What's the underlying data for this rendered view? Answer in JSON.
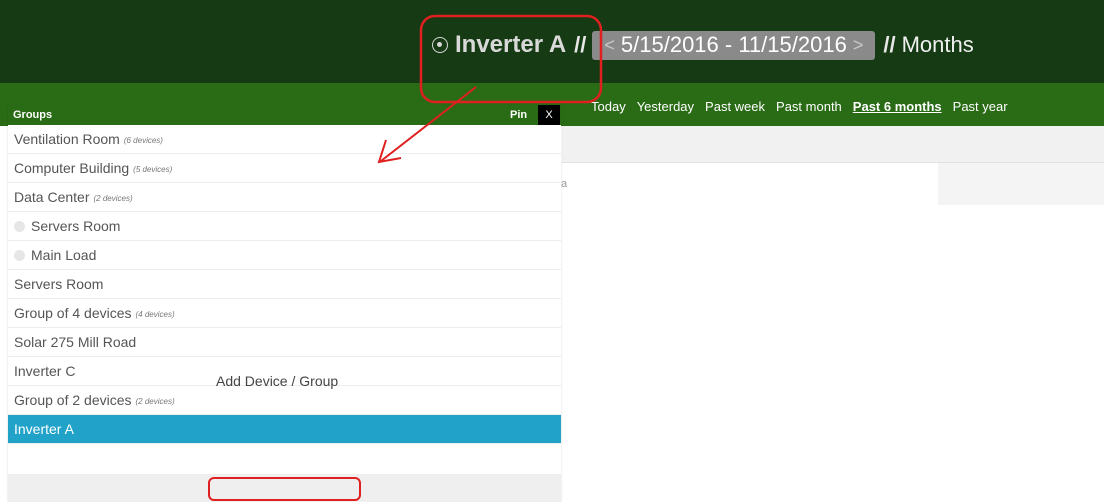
{
  "header": {
    "device_name": "Inverter A",
    "separator_1": "//",
    "date_range": "5/15/2016 - 11/15/2016",
    "separator_2": "//",
    "granularity": "Months",
    "prev_symbol": "<",
    "next_symbol": ">",
    "target_icon": "target-icon"
  },
  "period_links": [
    {
      "label": "Today"
    },
    {
      "label": "Yesterday"
    },
    {
      "label": "Past week"
    },
    {
      "label": "Past month"
    },
    {
      "label": "Past 6 months",
      "active": true
    },
    {
      "label": "Past year"
    }
  ],
  "groups_panel": {
    "title": "Groups",
    "pin_label": "Pin",
    "close_label": "X",
    "rows": [
      {
        "label": "Ventilation Room",
        "count": "(6 devices)"
      },
      {
        "label": "Computer Building",
        "count": "(5 devices)"
      },
      {
        "label": "Data Center",
        "count": "(2 devices)"
      },
      {
        "label": "Servers Room",
        "child": true
      },
      {
        "label": "Main Load",
        "child": true
      },
      {
        "label": "Servers Room"
      },
      {
        "label": "Group of 4 devices",
        "count": "(4 devices)"
      },
      {
        "label": "Solar 275 Mill Road"
      },
      {
        "label": "Inverter C"
      },
      {
        "label": "Group of 2 devices",
        "count": "(2 devices)"
      },
      {
        "label": "Inverter A",
        "selected": true
      }
    ],
    "add_link": "Add Device / Group"
  },
  "stray_text": "a",
  "colors": {
    "header_bg": "#163a14",
    "nav_bg": "#2a6b16",
    "selected_row": "#21a2c9",
    "annotation": "#e02020"
  }
}
